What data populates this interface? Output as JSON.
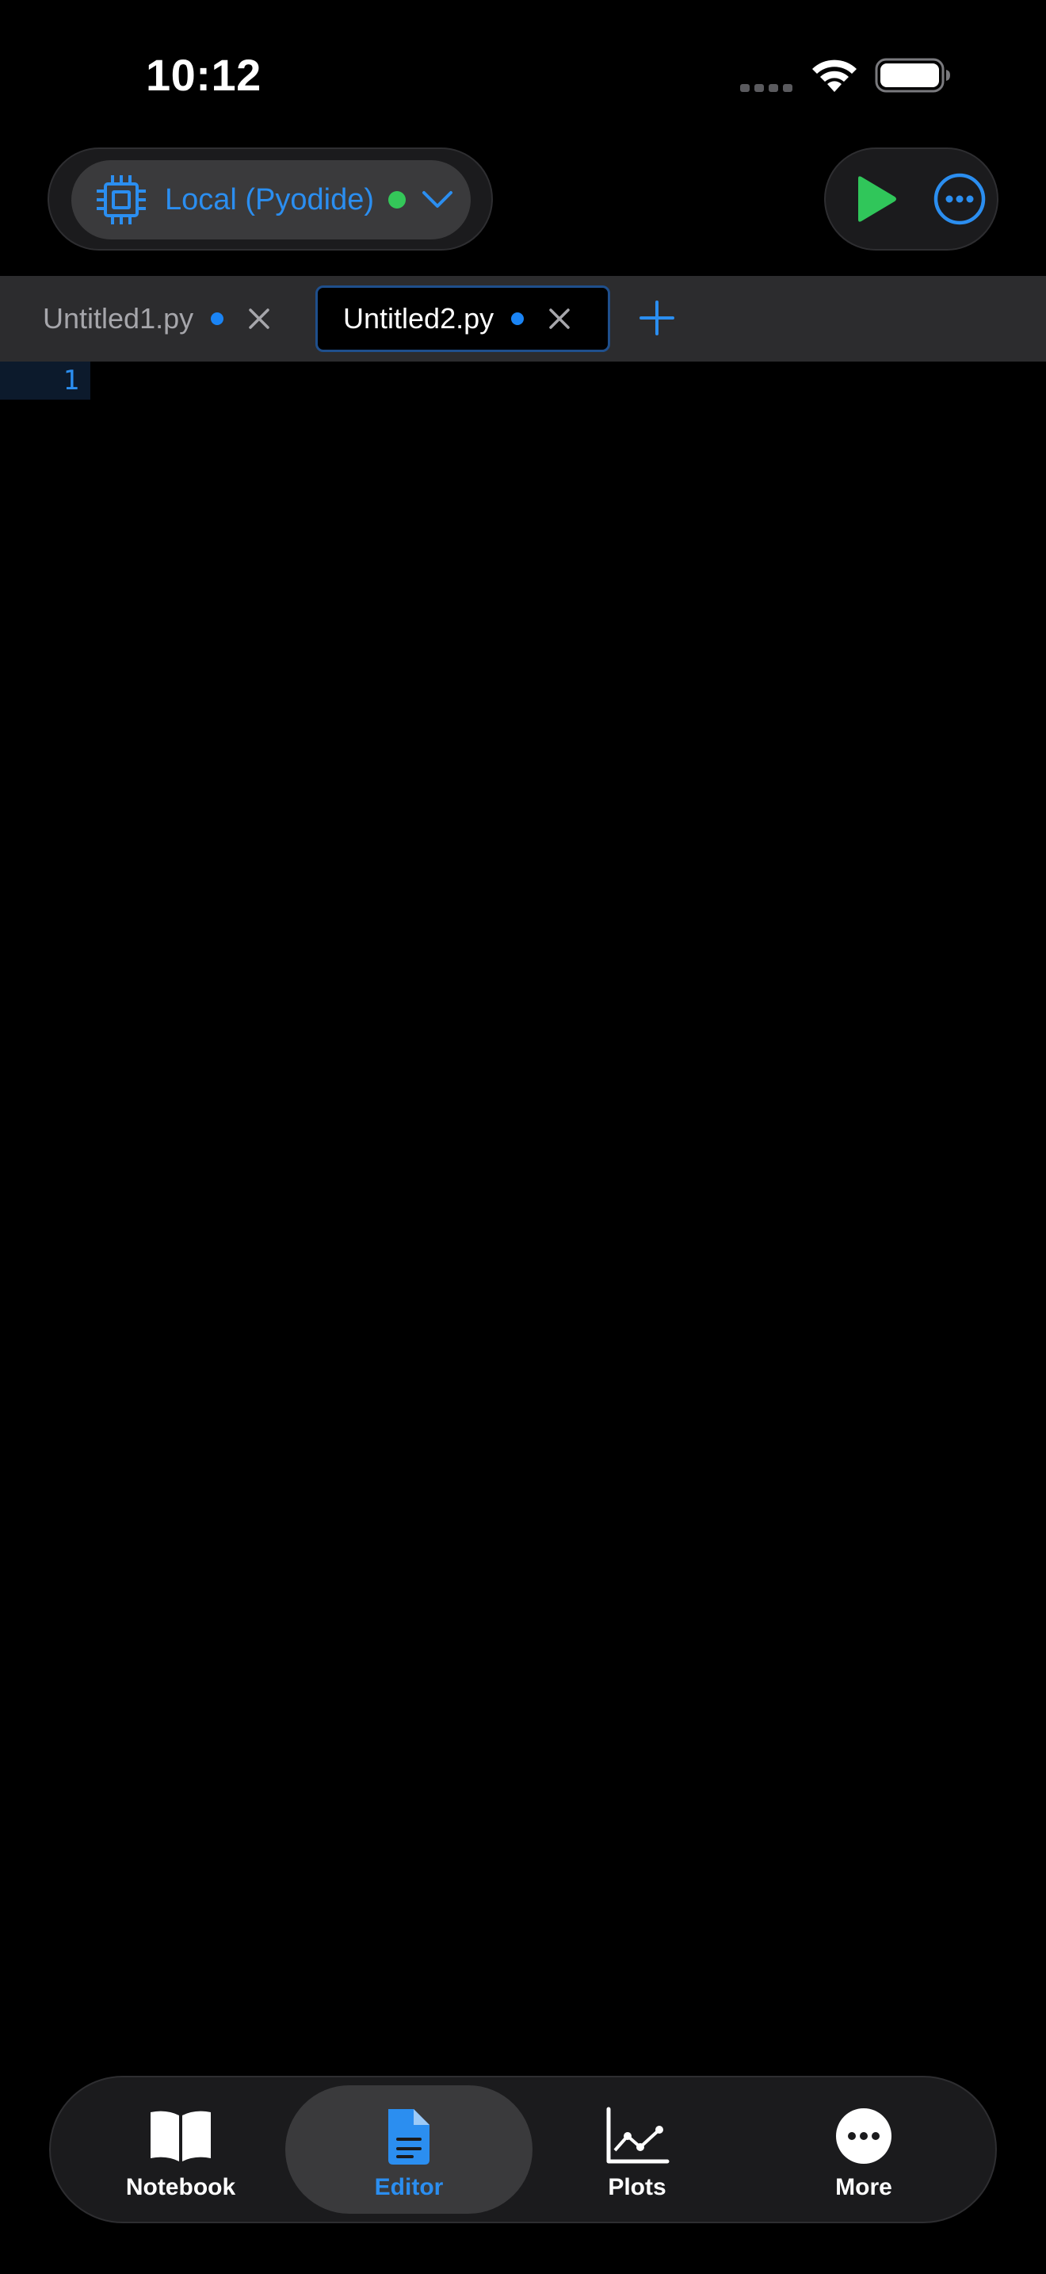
{
  "status_bar": {
    "time": "10:12"
  },
  "kernel": {
    "label": "Local (Pyodide)",
    "status_color": "#34c759",
    "accent": "#2b8ef0"
  },
  "actions": {
    "run_icon": "play-icon",
    "more_icon": "ellipsis-circle-icon"
  },
  "tabs": [
    {
      "label": "Untitled1.py",
      "modified": true,
      "active": false
    },
    {
      "label": "Untitled2.py",
      "modified": true,
      "active": true
    }
  ],
  "editor": {
    "line_numbers": [
      "1"
    ]
  },
  "bottom_nav": {
    "items": [
      {
        "label": "Notebook",
        "icon": "book-icon",
        "active": false
      },
      {
        "label": "Editor",
        "icon": "document-icon",
        "active": true
      },
      {
        "label": "Plots",
        "icon": "chart-icon",
        "active": false
      },
      {
        "label": "More",
        "icon": "ellipsis-circle-icon",
        "active": false
      }
    ]
  }
}
